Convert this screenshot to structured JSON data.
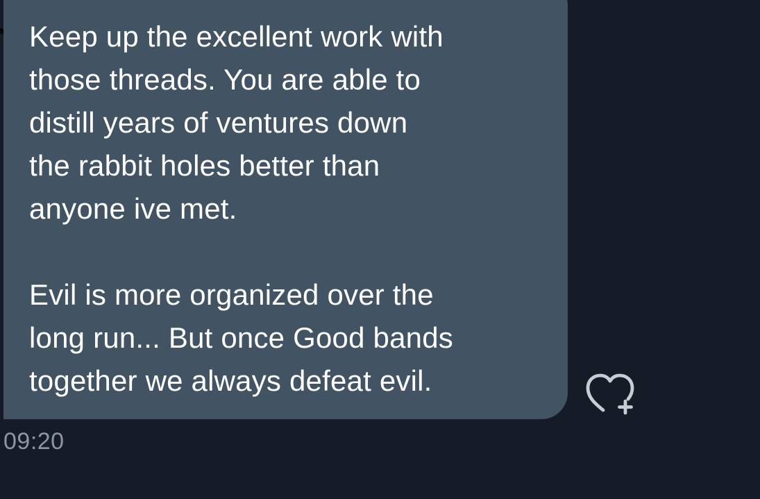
{
  "message": {
    "text": "Keep up the excellent work with\nthose threads. You are able to\ndistill years of ventures down\nthe rabbit holes better than\nanyone ive met.\n\nEvil is more organized over the\nlong run... But once Good bands\ntogether we always defeat evil.",
    "timestamp": "09:20",
    "reaction_icon": "heart-plus-icon"
  },
  "colors": {
    "background": "#151c27",
    "bubble": "#425464",
    "text": "#ffffff",
    "timestamp": "#8d96a1",
    "icon": "#c7cdd2"
  }
}
